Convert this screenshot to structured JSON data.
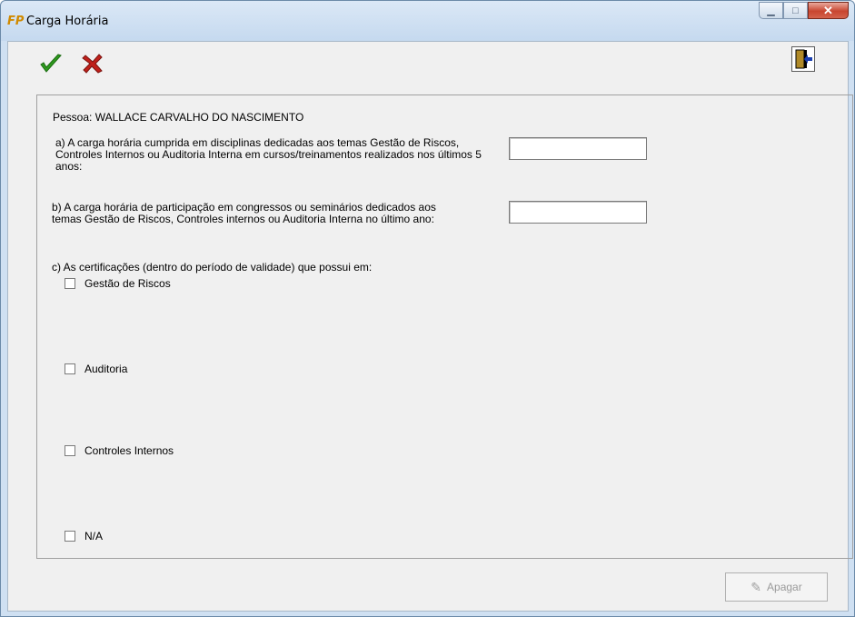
{
  "window": {
    "title": "Carga Horária",
    "icon": "FP"
  },
  "caption": {
    "minimize": "minimize-icon",
    "maximize": "maximize-icon",
    "close": "close-icon"
  },
  "toolbar": {
    "confirm": "check-icon",
    "cancel": "cross-icon",
    "exit": "exit-door-icon"
  },
  "form": {
    "person_label": "Pessoa: WALLACE CARVALHO DO NASCIMENTO",
    "question_a": "a)  A carga horária cumprida em disciplinas dedicadas aos temas Gestão de Riscos, Controles Internos ou Auditoria Interna em cursos/treinamentos realizados nos últimos 5 anos:",
    "question_a_value": "",
    "question_b": "b) A carga horária de participação em congressos ou seminários dedicados aos temas Gestão de Riscos, Controles internos ou Auditoria Interna no último ano:",
    "question_b_value": "",
    "question_c": "c) As certificações (dentro do período de validade) que possui em:",
    "options": [
      {
        "label": "Gestão de Riscos",
        "checked": false
      },
      {
        "label": "Auditoria",
        "checked": false
      },
      {
        "label": "Controles Internos",
        "checked": false
      },
      {
        "label": "N/A",
        "checked": false
      }
    ]
  },
  "footer": {
    "delete_label": "Apagar",
    "delete_enabled": false
  },
  "colors": {
    "confirm": "#2e9a1e",
    "cancel": "#c0201a"
  }
}
